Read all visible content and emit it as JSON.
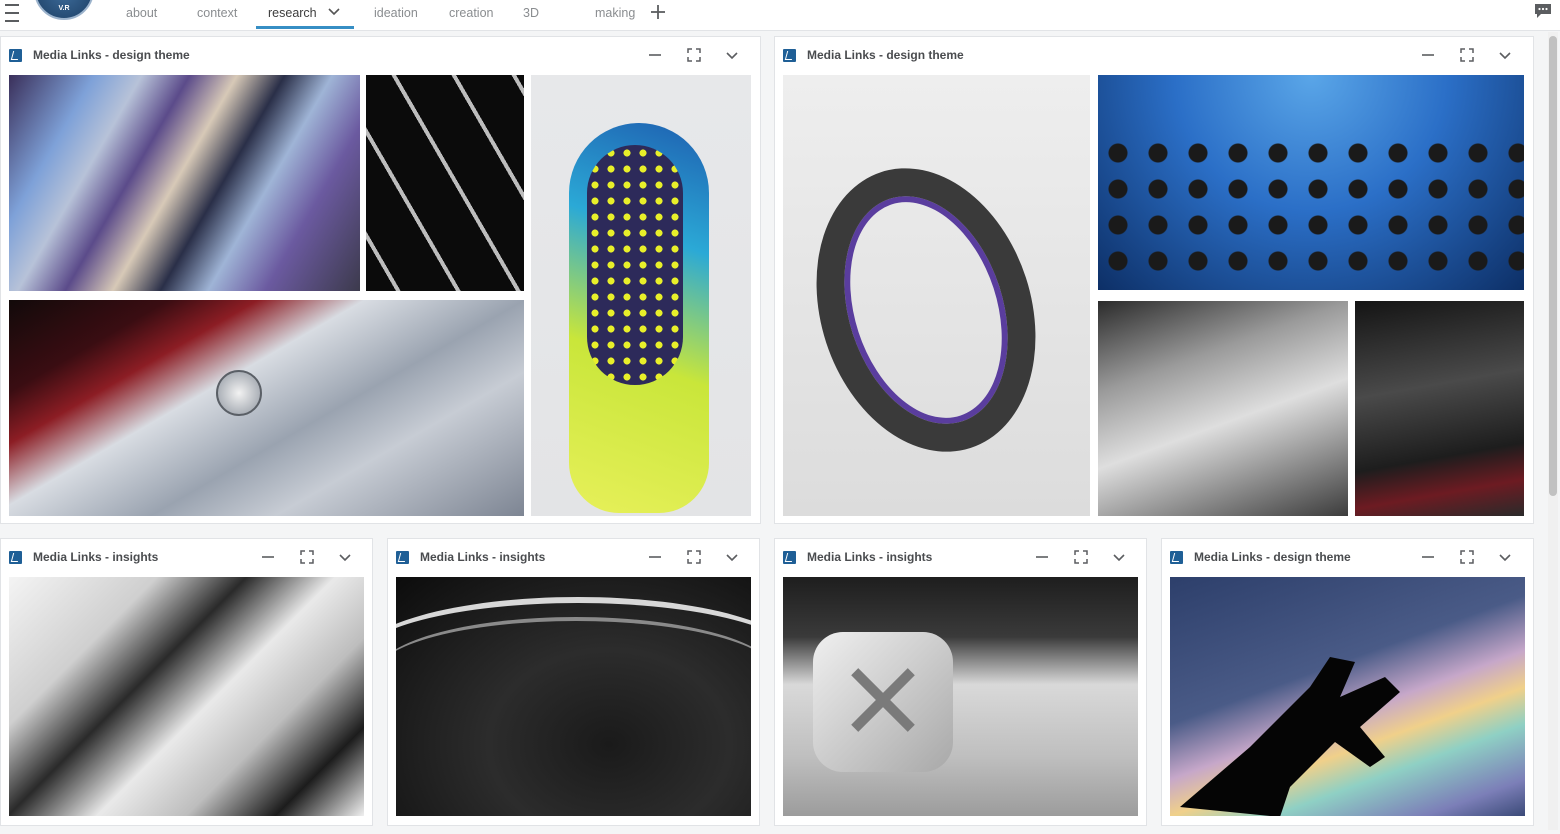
{
  "app": {
    "logo_text": "V.R",
    "tabs": [
      {
        "label": "about"
      },
      {
        "label": "context"
      },
      {
        "label": "research"
      },
      {
        "label": "ideation"
      },
      {
        "label": "creation"
      },
      {
        "label": "3D"
      },
      {
        "label": "making"
      }
    ],
    "active_tab": "research"
  },
  "panels": [
    {
      "title": "Media Links - design theme"
    },
    {
      "title": "Media Links - design theme"
    },
    {
      "title": "Media Links - insights"
    },
    {
      "title": "Media Links - insights"
    },
    {
      "title": "Media Links - insights"
    },
    {
      "title": "Media Links - design theme"
    }
  ],
  "icons": {
    "menu": "hamburger-icon",
    "add_tab": "plus-icon",
    "chat": "chat-icon",
    "minimize": "minimize-icon",
    "maximize": "expand-icon",
    "collapse": "chevron-down-icon"
  },
  "colors": {
    "accent": "#368ec4",
    "brand_icon": "#1f5f96"
  }
}
